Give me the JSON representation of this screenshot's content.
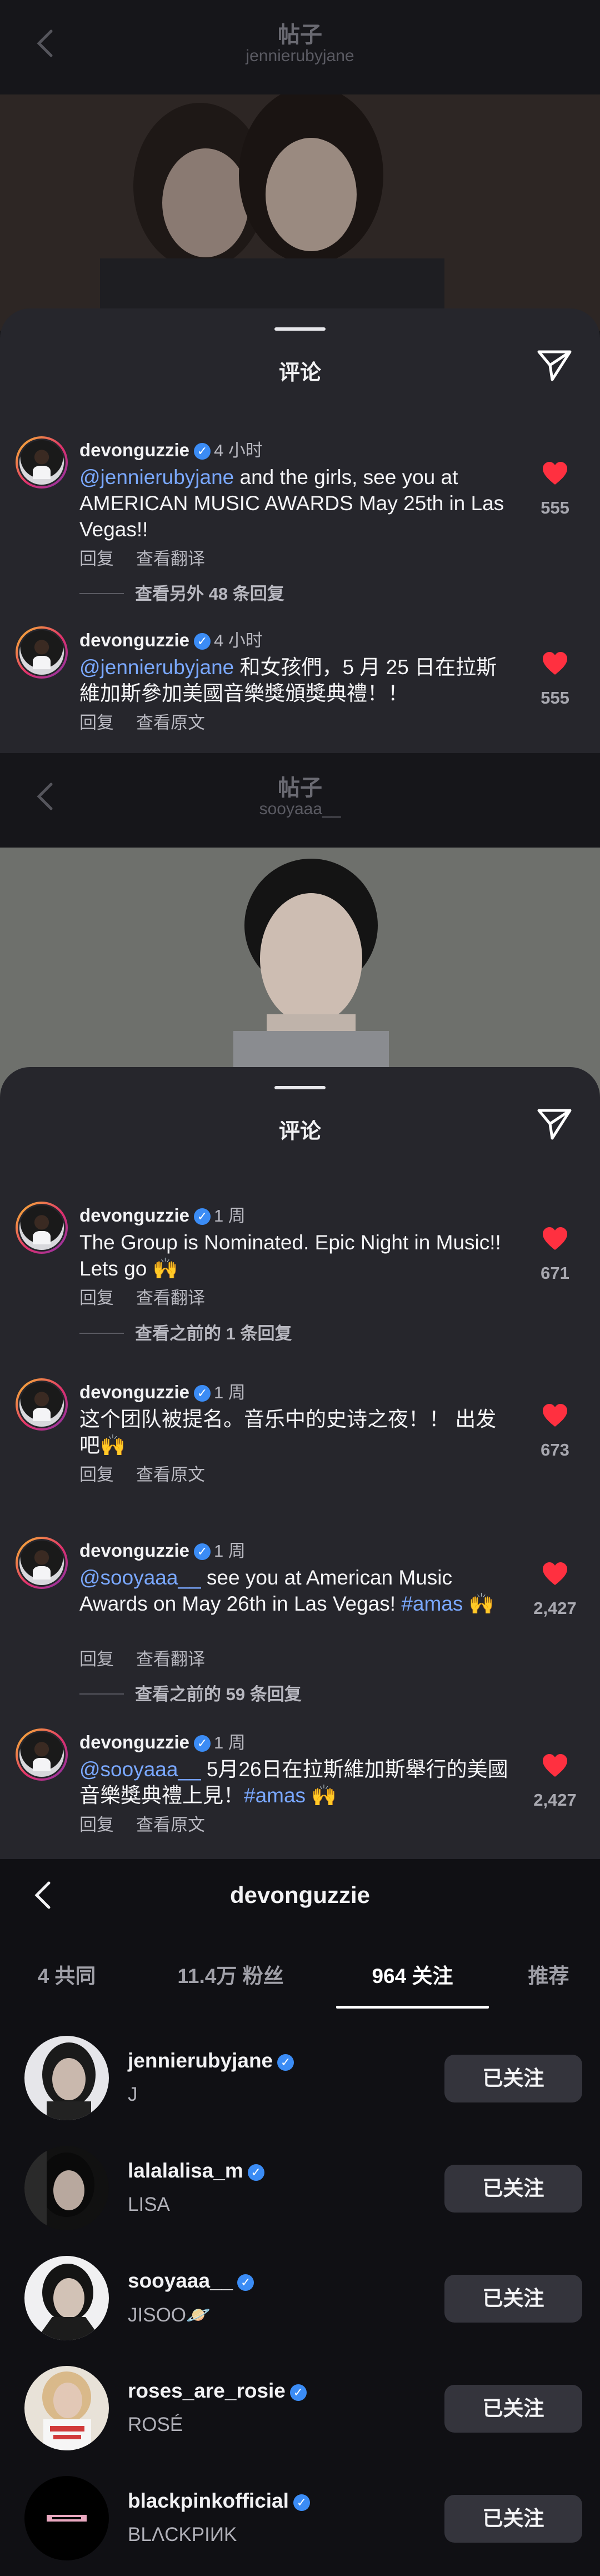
{
  "panel1": {
    "title": "帖子",
    "subtitle": "jennierubyjane",
    "sheet_title": "评论",
    "comments": [
      {
        "user": "devonguzzie",
        "time": "4 小时",
        "mention": "@jennierubyjane",
        "text": " and the girls, see you at AMERICAN MUSIC AWARDS May 25th in Las Vegas!!",
        "reply": "回复",
        "translate": "查看翻译",
        "likes": "555",
        "more": "查看另外 48 条回复"
      },
      {
        "user": "devonguzzie",
        "time": "4 小时",
        "mention": "@jennierubyjane",
        "text": " 和女孩們，5 月 25 日在拉斯維加斯參加美國音樂獎頒獎典禮！！",
        "reply": "回复",
        "translate": "查看原文",
        "likes": "555"
      }
    ]
  },
  "panel2": {
    "title": "帖子",
    "subtitle": "sooyaaa__",
    "sheet_title": "评论",
    "comments": [
      {
        "user": "devonguzzie",
        "time": "1 周",
        "mention": "",
        "text": "The Group is Nominated. Epic Night in Music!! Lets go 🙌",
        "reply": "回复",
        "translate": "查看翻译",
        "likes": "671",
        "more": "查看之前的 1 条回复"
      },
      {
        "user": "devonguzzie",
        "time": "1 周",
        "mention": "",
        "text": "这个团队被提名。音乐中的史诗之夜！！ 出发吧🙌",
        "reply": "回复",
        "translate": "查看原文",
        "likes": "673"
      },
      {
        "user": "devonguzzie",
        "time": "1 周",
        "mention": "@sooyaaa__",
        "text": " see you at American Music Awards on May 26th in Las Vegas! ",
        "hashtag": "#amas",
        "tail": " 🙌",
        "reply": "回复",
        "translate": "查看翻译",
        "likes": "2,427",
        "more": "查看之前的 59 条回复"
      },
      {
        "user": "devonguzzie",
        "time": "1 周",
        "mention": "@sooyaaa__",
        "text": " 5月26日在拉斯維加斯舉行的美國音樂獎典禮上見！",
        "hashtag": "#amas",
        "tail": " 🙌",
        "reply": "回复",
        "translate": "查看原文",
        "likes": "2,427"
      }
    ]
  },
  "panel3": {
    "title": "devonguzzie",
    "tabs": [
      "4 共同",
      "11.4万 粉丝",
      "964 关注",
      "推荐"
    ],
    "active_tab": "964 关注",
    "button_label": "已关注",
    "rows": [
      {
        "user": "jennierubyjane",
        "name": "J"
      },
      {
        "user": "lalalalisa_m",
        "name": "LISA"
      },
      {
        "user": "sooyaaa__",
        "name": "JISOO🪐"
      },
      {
        "user": "roses_are_rosie",
        "name": "ROSÉ"
      },
      {
        "user": "blackpinkofficial",
        "name": "BLΛCKPIИK"
      }
    ]
  },
  "colors": {
    "heart": "#ff3040",
    "verified": "#3b8cf5",
    "mention": "#7aa8ff"
  },
  "icons": [
    "back-chevron-icon",
    "share-send-icon",
    "heart-icon",
    "verified-badge-icon"
  ]
}
